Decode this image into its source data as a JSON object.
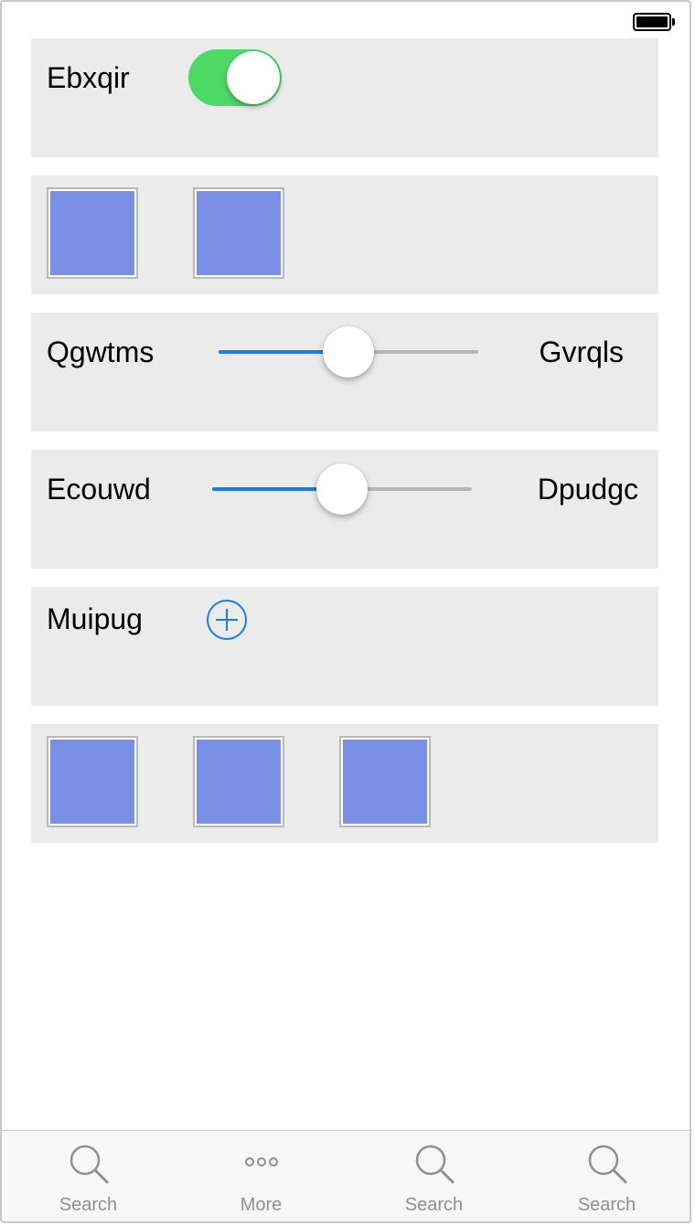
{
  "status_bar": {
    "battery_level": 1.0
  },
  "rows": {
    "toggle_row": {
      "label": "Ebxqir",
      "toggle_on": true,
      "toggle_color": "#4cd964"
    },
    "slider_row_1": {
      "left_label": "Qgwtms",
      "right_label": "Gvrqls",
      "value": 0.5
    },
    "slider_row_2": {
      "left_label": "Ecouwd",
      "right_label": "Dpudgc",
      "value": 0.5
    },
    "add_row": {
      "label": "Muipug",
      "icon": "plus-circle-icon"
    },
    "image_row_1": {
      "count": 2,
      "fill_color": "#7a90e4"
    },
    "image_row_2": {
      "count": 3,
      "fill_color": "#7a90e4"
    }
  },
  "accent_color": "#1a7cf0",
  "tab_bar": {
    "tabs": [
      {
        "label": "Search",
        "icon": "search-icon"
      },
      {
        "label": "More",
        "icon": "more-icon"
      },
      {
        "label": "Search",
        "icon": "search-icon"
      },
      {
        "label": "Search",
        "icon": "search-icon"
      }
    ]
  }
}
